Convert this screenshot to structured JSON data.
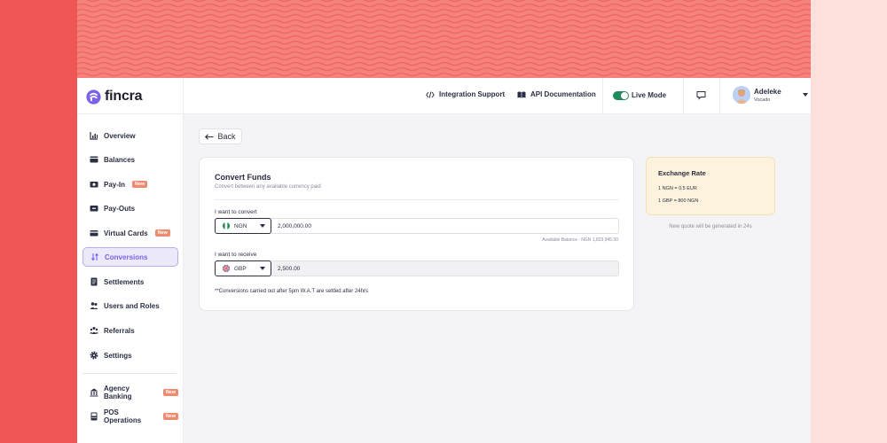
{
  "app": {
    "brand": "fincra"
  },
  "colors": {
    "accent": "#7b61e8",
    "live_toggle": "#1f8a5c",
    "badge": "#f08a6e",
    "rate_card_bg": "#fdf3dc"
  },
  "header": {
    "integration_support": "Integration Support",
    "api_documentation": "API Documentation",
    "live_mode": "Live Mode",
    "user_name": "Adeleke",
    "user_org": "Vocado"
  },
  "sidebar": {
    "items": [
      {
        "label": "Overview",
        "icon": "chart-icon"
      },
      {
        "label": "Balances",
        "icon": "wallet-icon"
      },
      {
        "label": "Pay-In",
        "icon": "pay-in-icon",
        "badge": "New"
      },
      {
        "label": "Pay-Outs",
        "icon": "pay-out-icon"
      },
      {
        "label": "Virtual Cards",
        "icon": "card-icon",
        "badge": "New"
      },
      {
        "label": "Conversions",
        "icon": "convert-icon",
        "active": true
      },
      {
        "label": "Settlements",
        "icon": "settlement-icon"
      },
      {
        "label": "Users and Roles",
        "icon": "users-icon"
      },
      {
        "label": "Referrals",
        "icon": "referrals-icon"
      },
      {
        "label": "Settings",
        "icon": "gear-icon"
      },
      {
        "label": "Agency Banking",
        "icon": "bank-icon",
        "badge": "New"
      },
      {
        "label": "POS Operations",
        "icon": "pos-icon",
        "badge": "New"
      }
    ]
  },
  "main": {
    "back_label": "Back",
    "convert": {
      "title": "Convert Funds",
      "subtitle": "Convert between any available currency paid",
      "from_label": "I want to convert",
      "from_currency": "NGN",
      "from_amount": "2,000,000.00",
      "available_balance": "Available Balance - NGN 1,823,945.00",
      "to_label": "I want to receive",
      "to_currency": "GBP",
      "to_amount": "2,500.00",
      "note": "**Conversions carried out after 5pm W.A.T are settled after 24hrs"
    },
    "exchange": {
      "title": "Exchange Rate",
      "rate_1": "1 NGN = 0.5 EUR",
      "rate_2": "1 GBP = 800 NGN",
      "quote_note": "New quote will be generated in 24s"
    }
  }
}
